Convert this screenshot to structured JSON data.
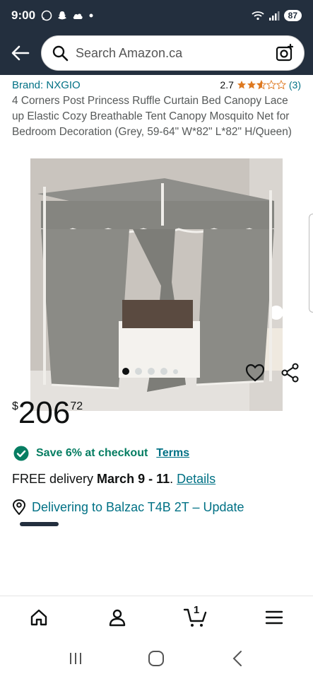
{
  "status_bar": {
    "time": "9:00",
    "battery": "87",
    "icons_left": [
      "whatsapp-icon",
      "snapchat-icon",
      "cloud-icon",
      "dot-icon"
    ],
    "icons_right": [
      "wifi-icon",
      "signal-icon",
      "battery-icon"
    ]
  },
  "header": {
    "search_placeholder": "Search Amazon.ca",
    "icons": [
      "back-arrow-icon",
      "search-icon",
      "camera-search-icon"
    ]
  },
  "product": {
    "brand": "Brand: NXGIO",
    "rating_value": "2.7",
    "rating_stars": 2.7,
    "rating_count": "(3)",
    "title": "4 Corners Post Princess Ruffle Curtain Bed Canopy Lace up Elastic Cozy Breathable Tent Canopy Mosquito Net for Bedroom Decoration (Grey, 59-64\" W*82\" L*82\" H/Queen)",
    "image_count": 5,
    "active_image": 1,
    "price_symbol": "$",
    "price_whole": "206",
    "price_fraction": "72",
    "save_text": "Save 6% at checkout",
    "terms_label": "Terms",
    "delivery_prefix": "FREE delivery ",
    "delivery_date": "March 9 - 11",
    "delivery_suffix": ". ",
    "details_label": "Details",
    "location_text": "Delivering to Balzac T4B 2T – Update"
  },
  "bottom_nav": {
    "cart_count": "1",
    "items": [
      "home-icon",
      "account-icon",
      "cart-icon",
      "menu-icon"
    ]
  },
  "colors": {
    "header_bg": "#232f3e",
    "link": "#007185",
    "save_green": "#067d62"
  }
}
